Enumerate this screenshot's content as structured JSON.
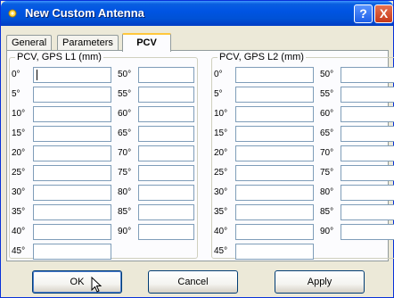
{
  "window": {
    "title": "New Custom Antenna",
    "help_label": "?",
    "close_label": "X"
  },
  "tabs": [
    {
      "label": "General",
      "active": false
    },
    {
      "label": "Parameters",
      "active": false
    },
    {
      "label": "PCV",
      "active": true
    }
  ],
  "groups": [
    {
      "label": "PCV, GPS L1 (mm)",
      "left_angles": [
        "0°",
        "5°",
        "10°",
        "15°",
        "20°",
        "25°",
        "30°",
        "35°",
        "40°",
        "45°"
      ],
      "right_angles": [
        "50°",
        "55°",
        "60°",
        "65°",
        "70°",
        "75°",
        "80°",
        "85°",
        "90°"
      ]
    },
    {
      "label": "PCV, GPS L2 (mm)",
      "left_angles": [
        "0°",
        "5°",
        "10°",
        "15°",
        "20°",
        "25°",
        "30°",
        "35°",
        "40°",
        "45°"
      ],
      "right_angles": [
        "50°",
        "55°",
        "60°",
        "65°",
        "70°",
        "75°",
        "80°",
        "85°",
        "90°"
      ]
    }
  ],
  "buttons": {
    "ok": "OK",
    "cancel": "Cancel",
    "apply": "Apply"
  },
  "icons": {
    "title": "antenna-icon",
    "cursor": "mouse-pointer-icon"
  }
}
